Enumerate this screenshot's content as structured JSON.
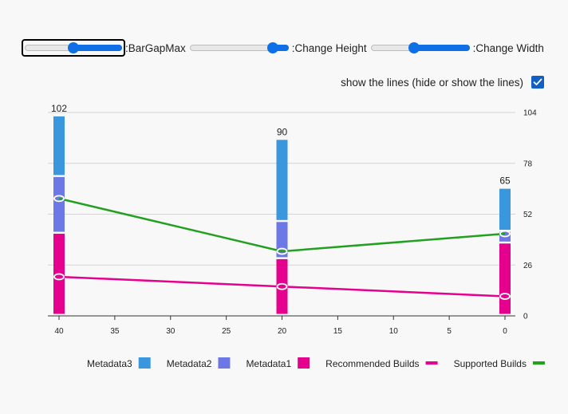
{
  "controls": {
    "sliders": [
      {
        "label": ":BarGapMax",
        "value": 0.5
      },
      {
        "label": ":Change Height",
        "value": 0.84
      },
      {
        "label": ":Change Width",
        "value": 0.44
      }
    ],
    "show_lines": {
      "label": "show the lines (hide or show the lines)",
      "checked": true
    }
  },
  "chart_data": {
    "type": "bar",
    "x": [
      40,
      20,
      0
    ],
    "bar_totals": [
      "102",
      "90",
      "65"
    ],
    "x_ticks": [
      "40",
      "35",
      "30",
      "25",
      "20",
      "15",
      "10",
      "5",
      "0"
    ],
    "y_ticks": [
      "0",
      "26",
      "52",
      "78",
      "104"
    ],
    "ylim": [
      0,
      104
    ],
    "xlim": [
      40,
      0
    ],
    "grid": true,
    "series": [
      {
        "name": "Metadata1",
        "kind": "bar",
        "color": "#e5008d",
        "values": [
          42,
          29,
          37
        ]
      },
      {
        "name": "Metadata2",
        "kind": "bar",
        "color": "#6b78e5",
        "values": [
          29,
          19,
          6
        ]
      },
      {
        "name": "Metadata3",
        "kind": "bar",
        "color": "#3a97de",
        "values": [
          31,
          42,
          22
        ]
      },
      {
        "name": "Recommended Builds",
        "kind": "line",
        "color": "#e5008d",
        "values": [
          20,
          15,
          10
        ]
      },
      {
        "name": "Supported Builds",
        "kind": "line",
        "color": "#22a020",
        "values": [
          60,
          33,
          42
        ]
      }
    ],
    "legend": [
      {
        "name": "Metadata3",
        "color": "#3a97de",
        "swatch": "box"
      },
      {
        "name": "Metadata2",
        "color": "#6b78e5",
        "swatch": "box"
      },
      {
        "name": "Metadata1",
        "color": "#e5008d",
        "swatch": "box"
      },
      {
        "name": "Recommended Builds",
        "color": "#e5008d",
        "swatch": "line"
      },
      {
        "name": "Supported Builds",
        "color": "#22a020",
        "swatch": "line"
      }
    ]
  }
}
